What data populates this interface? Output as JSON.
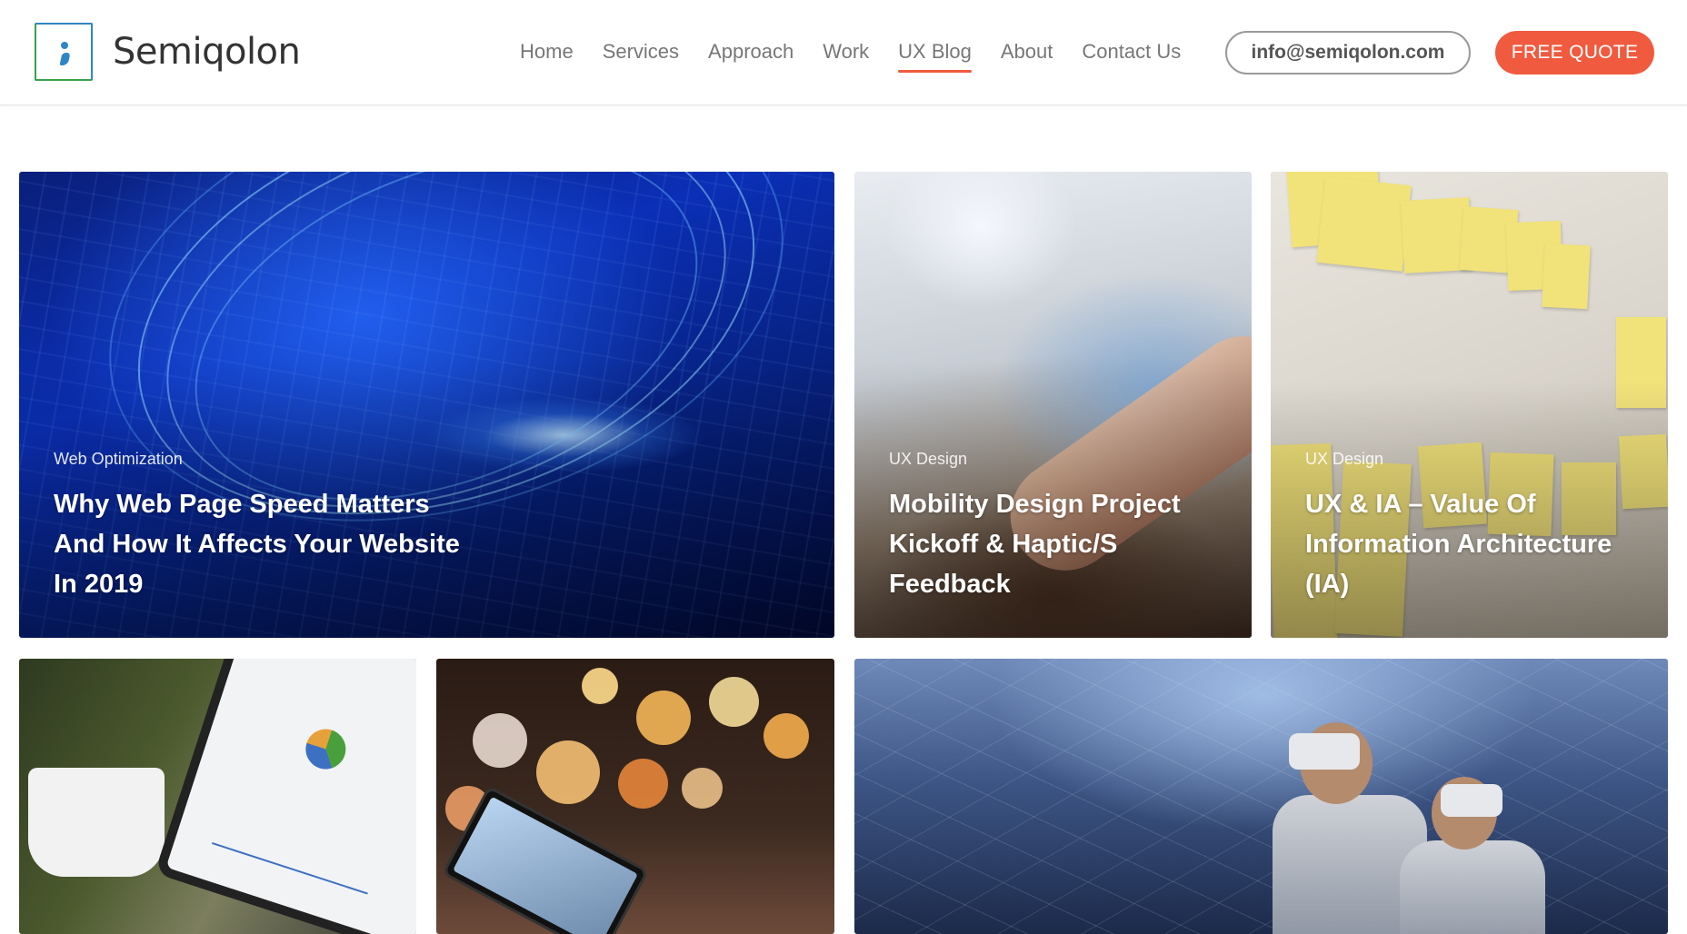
{
  "brand": {
    "name": "Semiqolon"
  },
  "nav": {
    "items": [
      {
        "label": "Home"
      },
      {
        "label": "Services"
      },
      {
        "label": "Approach"
      },
      {
        "label": "Work"
      },
      {
        "label": "UX Blog",
        "active": true
      },
      {
        "label": "About"
      },
      {
        "label": "Contact Us"
      }
    ]
  },
  "header": {
    "email_label": "info@semiqolon.com",
    "quote_label": "FREE QUOTE"
  },
  "colors": {
    "accent": "#f05a3e",
    "logo_blue": "#2f86c6",
    "logo_green": "#3aa34a"
  },
  "posts": [
    {
      "category": "Web Optimization",
      "title": "Why Web Page Speed Matters And How It Affects Your Website In 2019"
    },
    {
      "category": "UX Design",
      "title": "Mobility Design Project Kickoff & Haptic/S Feedback"
    },
    {
      "category": "UX Design",
      "title": "UX & IA – Value Of Information Architecture (IA)"
    }
  ]
}
